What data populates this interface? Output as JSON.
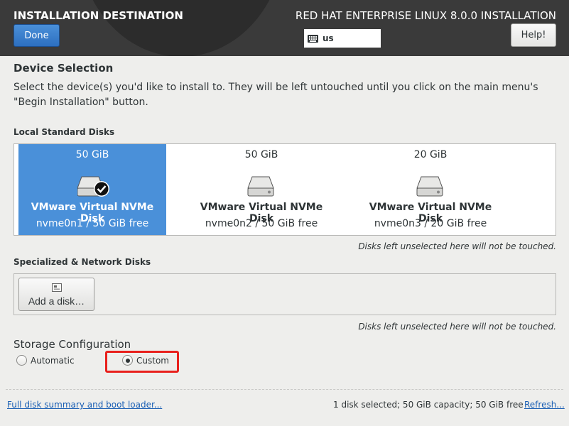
{
  "header": {
    "title": "INSTALLATION DESTINATION",
    "product": "RED HAT ENTERPRISE LINUX 8.0.0 INSTALLATION",
    "done_label": "Done",
    "help_label": "Help!",
    "keyboard_layout": "us"
  },
  "device_selection": {
    "heading": "Device Selection",
    "description": "Select the device(s) you'd like to install to.  They will be left untouched until you click on the main menu's \"Begin Installation\" button."
  },
  "local_disks": {
    "label": "Local Standard Disks",
    "disks": [
      {
        "size": "50 GiB",
        "name": "VMware Virtual NVMe Disk",
        "info": "nvme0n1   /   50 GiB free",
        "selected": true
      },
      {
        "size": "50 GiB",
        "name": "VMware Virtual NVMe Disk",
        "info": "nvme0n2   /   50 GiB free",
        "selected": false
      },
      {
        "size": "20 GiB",
        "name": "VMware Virtual NVMe Disk",
        "info": "nvme0n3   /   20 GiB free",
        "selected": false
      }
    ],
    "note": "Disks left unselected here will not be touched."
  },
  "specialized_disks": {
    "label": "Specialized & Network Disks",
    "add_label": "Add a disk…",
    "note": "Disks left unselected here will not be touched."
  },
  "storage_config": {
    "heading": "Storage Configuration",
    "automatic_label": "Automatic",
    "custom_label": "Custom",
    "selected": "custom"
  },
  "footer": {
    "summary_link": "Full disk summary and boot loader...",
    "status": "1 disk selected; 50 GiB capacity; 50 GiB free",
    "refresh_link": "Refresh..."
  },
  "colors": {
    "selected_disk": "#4a90d9",
    "header_bg": "#3a3a3a",
    "highlight": "#e8201c",
    "link": "#1a5fb4"
  }
}
